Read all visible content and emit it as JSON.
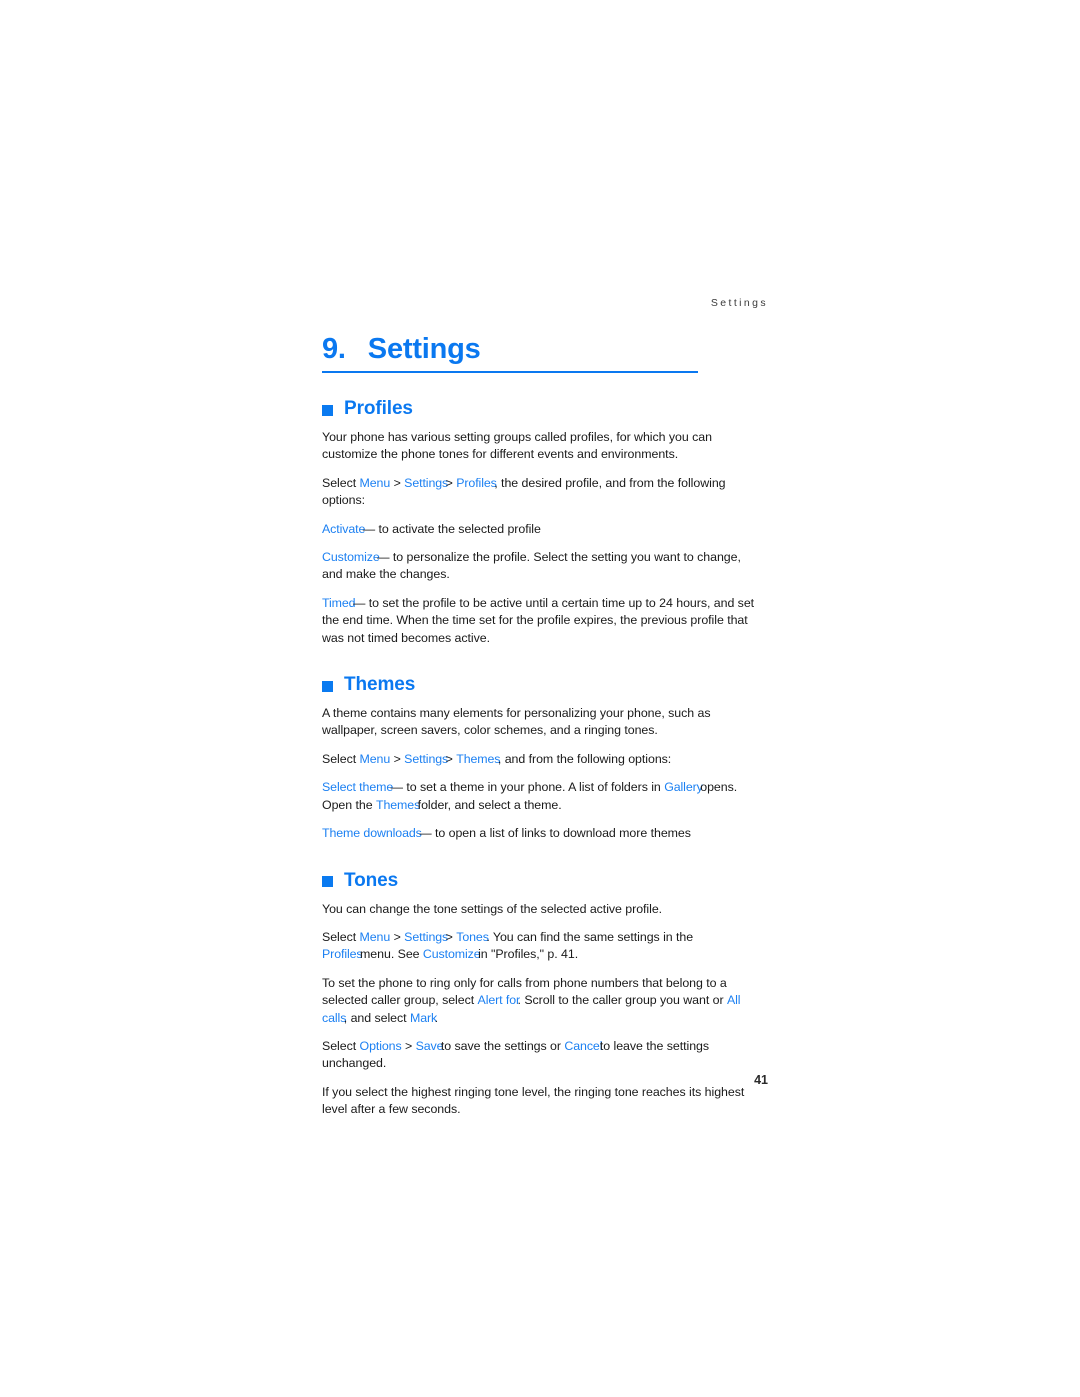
{
  "document": {
    "running_header": "Settings",
    "page_number": "41"
  },
  "chapter": {
    "number": "9.",
    "title": "Settings"
  },
  "sections": [
    {
      "id": "profiles",
      "heading": "Profiles",
      "paragraphs": {
        "intro": "Your phone has various setting groups called profiles, for which you can customize the phone tones for different events and environments.",
        "select_lead": "Select",
        "select_menu": "Menu",
        "select_sep1": ">",
        "select_settings": "Settings",
        "select_sep2": ">",
        "select_profiles": "Profiles",
        "select_tail": ", the desired profile, and from the following options:",
        "activate_term": "Activate",
        "activate_tail": "— to activate the selected profile",
        "customize_term": "Customize",
        "customize_tail": "— to personalize the profile. Select the setting you want to change, and make the changes.",
        "timed_term": "Timed",
        "timed_tail": "— to set the profile to be active until a certain time up to 24 hours, and set the end time. When the time set for the profile expires, the previous profile that was not timed becomes active."
      }
    },
    {
      "id": "themes",
      "heading": "Themes",
      "paragraphs": {
        "intro": "A theme contains many elements for personalizing your phone, such as wallpaper, screen savers, color schemes, and a ringing tones.",
        "select_lead": "Select",
        "select_menu": "Menu",
        "select_sep1": ">",
        "select_settings": "Settings",
        "select_sep2": ">",
        "select_themes": "Themes",
        "select_tail": ", and from the following options:",
        "select_theme_term": "Select theme",
        "select_theme_mid": "— to set a theme in your phone. A list of folders in",
        "gallery_term": "Gallery",
        "select_theme_mid2": "opens. Open the",
        "themes_folder_term": "Themes",
        "select_theme_tail": "folder, and select a theme.",
        "downloads_term": "Theme downloads",
        "downloads_tail": "— to open a list of links to download more themes"
      }
    },
    {
      "id": "tones",
      "heading": "Tones",
      "paragraphs": {
        "intro": "You can change the tone settings of the selected active profile.",
        "select_lead": "Select",
        "select_menu": "Menu",
        "select_sep1": ">",
        "select_settings": "Settings",
        "select_sep2": ">",
        "select_tones": "Tones",
        "select_mid": ". You can find the same settings in the",
        "profiles_term": "Profiles",
        "select_mid2": "menu. See",
        "customize_term": "Customize",
        "select_tail": "in \"Profiles,\" p. 41.",
        "caller_lead": "To set the phone to ring only for calls from phone numbers that belong to a selected caller group, select",
        "alert_for_term": "Alert for",
        "caller_mid": ". Scroll to the caller group you want or",
        "all_calls_term": "All calls",
        "caller_mid2": ", and select",
        "mark_term": "Mark",
        "caller_tail": ".",
        "save_lead": "Select",
        "options_term": "Options",
        "save_sep": ">",
        "save_term": "Save",
        "save_mid": "to save the settings or",
        "cancel_term": "Cancel",
        "save_tail": "to leave the settings unchanged.",
        "highest": "If you select the highest ringing tone level, the ringing tone reaches its highest level after a few seconds."
      }
    }
  ],
  "colors": {
    "accent_blue": "#0a78f0",
    "link_blue": "#1c80f2",
    "body_text": "#1a1a1a",
    "header_text": "#3a3a3a",
    "page_background": "#ffffff"
  }
}
